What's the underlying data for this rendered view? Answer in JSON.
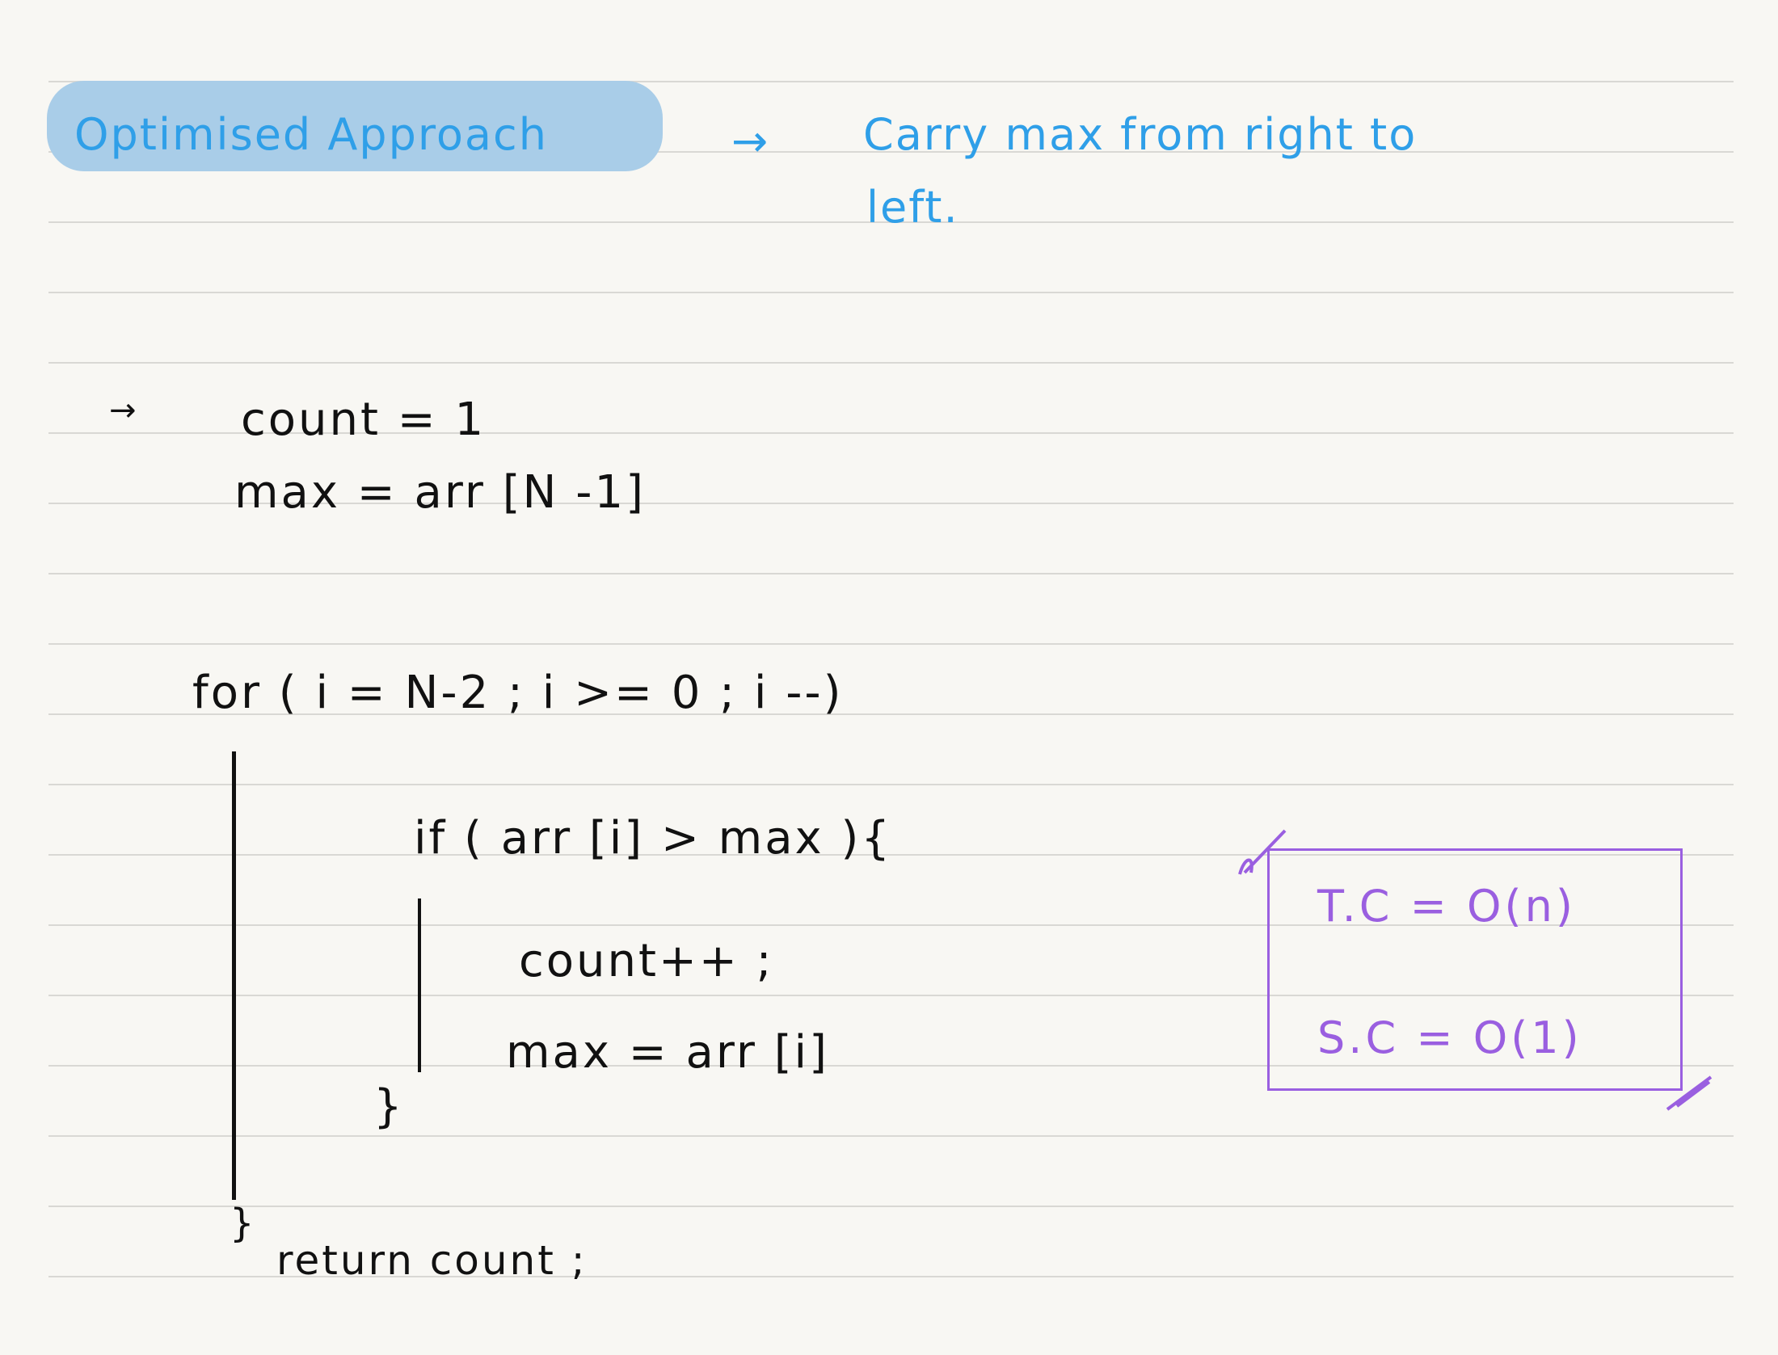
{
  "title": "Optimised Approach",
  "note": {
    "line1": "Carry   max   from   right  to",
    "line2": "left."
  },
  "code": {
    "count_init": "count = 1",
    "max_init": "max =   arr [N -1]",
    "for_header": "for  ( i = N-2   ;   i >= 0   ;   i --)",
    "if_line": "if ( arr [i]  > max ){",
    "count_inc": "count++ ;",
    "max_assign": "max   =   arr [i]",
    "if_close": "}",
    "for_close": "}",
    "return_line": "return  count ;"
  },
  "complexity": {
    "time": "T.C = O(n)",
    "space": "S.C = O(1)"
  },
  "colors": {
    "paper": "#f8f7f3",
    "rule": "#d9d8d4",
    "ink": "#111111",
    "blue_ink": "#2f9fe8",
    "highlight": "#a9cde8",
    "purple_ink": "#9a5fe0"
  }
}
